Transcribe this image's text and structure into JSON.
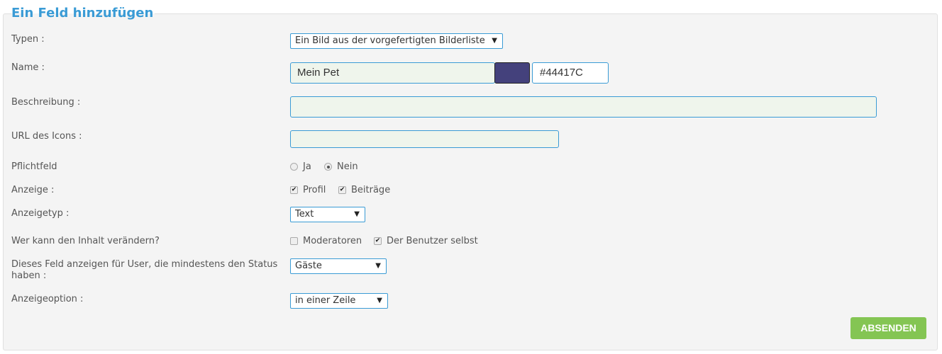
{
  "form": {
    "title": "Ein Feld hinzufügen",
    "labels": {
      "typen": "Typen :",
      "name": "Name :",
      "beschreibung": "Beschreibung :",
      "url_icon": "URL des Icons :",
      "pflichtfeld": "Pflichtfeld",
      "anzeige": "Anzeige :",
      "anzeigetyp": "Anzeigetyp :",
      "wer_kann": "Wer kann den Inhalt verändern?",
      "status_line1": "Dieses Feld anzeigen für User, die mindestens den Status",
      "status_line2": "haben :",
      "anzeigeoption": "Anzeigeoption :"
    },
    "typen_select": "Ein Bild aus der vorgefertigten Bilderliste",
    "name_value": "Mein Pet",
    "name_color": "#44417C",
    "color_hex_value": "#44417C",
    "beschreibung_value": "",
    "url_icon_value": "",
    "pflichtfeld_options": [
      {
        "label": "Ja",
        "selected": false
      },
      {
        "label": "Nein",
        "selected": true
      }
    ],
    "anzeige_options": [
      {
        "label": "Profil",
        "checked": true
      },
      {
        "label": "Beiträge",
        "checked": true
      }
    ],
    "anzeigetyp_select": "Text",
    "wer_kann_options": [
      {
        "label": "Moderatoren",
        "checked": false
      },
      {
        "label": "Der Benutzer selbst",
        "checked": true
      }
    ],
    "status_select": "Gäste",
    "anzeigeoption_select": "in einer Zeile",
    "submit_label": "ABSENDEN",
    "dropdown_arrow": "▼",
    "check_glyph": "✔"
  }
}
